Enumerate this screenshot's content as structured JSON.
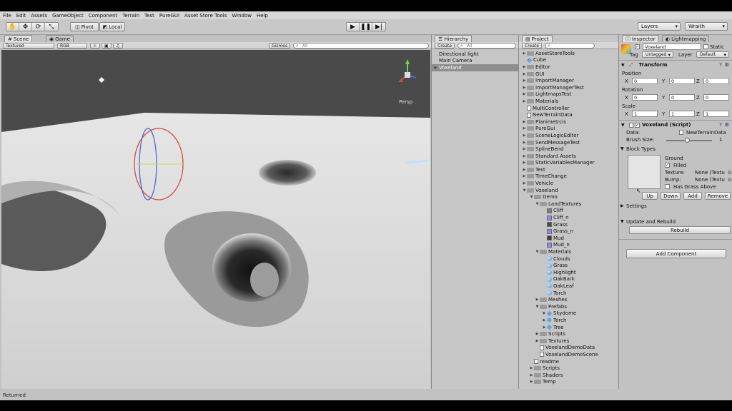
{
  "menu": [
    "File",
    "Edit",
    "Assets",
    "GameObject",
    "Component",
    "Terrain",
    "Test",
    "PureGUI",
    "Asset Store Tools",
    "Window",
    "Help"
  ],
  "toolbar": {
    "pivot_label": "Pivot",
    "local_label": "Local",
    "layers_label": "Layers",
    "layout_label": "Wraith"
  },
  "scene": {
    "tab_scene": "Scene",
    "tab_game": "Game",
    "render_mode": "Textured",
    "color_mode": "RGB",
    "gizmos_label": "Gizmos",
    "search_placeholder": "All",
    "persp_label": "Persp",
    "status_text": "Returned"
  },
  "hierarchy": {
    "tab": "Hierarchy",
    "create_label": "Create",
    "search_placeholder": "All",
    "items": [
      "Directional light",
      "Main Camera",
      "Voxeland"
    ],
    "selected": "Voxeland"
  },
  "project": {
    "tab": "Project",
    "create_label": "Create",
    "items": [
      {
        "label": "AssetStoreTools",
        "icon": "folder-icon",
        "indent": 0,
        "arrow": "▶"
      },
      {
        "label": "Cube",
        "icon": "prefab-icon",
        "indent": 0,
        "arrow": ""
      },
      {
        "label": "Editor",
        "icon": "folder-icon",
        "indent": 0,
        "arrow": "▶"
      },
      {
        "label": "GUI",
        "icon": "folder-icon",
        "indent": 0,
        "arrow": "▶"
      },
      {
        "label": "ImportManager",
        "icon": "folder-icon",
        "indent": 0,
        "arrow": "▶"
      },
      {
        "label": "ImportManagerTest",
        "icon": "folder-icon",
        "indent": 0,
        "arrow": "▶"
      },
      {
        "label": "LightmapsTest",
        "icon": "folder-icon",
        "indent": 0,
        "arrow": "▶"
      },
      {
        "label": "Materials",
        "icon": "folder-icon",
        "indent": 0,
        "arrow": "▶"
      },
      {
        "label": "MultiController",
        "icon": "script-icon",
        "indent": 0,
        "arrow": ""
      },
      {
        "label": "NewTerrainData",
        "icon": "asset-icon",
        "indent": 0,
        "arrow": ""
      },
      {
        "label": "Planimetrcis",
        "icon": "folder-icon",
        "indent": 0,
        "arrow": "▶"
      },
      {
        "label": "PureGui",
        "icon": "folder-icon",
        "indent": 0,
        "arrow": "▶"
      },
      {
        "label": "SceneLogicEditor",
        "icon": "folder-icon",
        "indent": 0,
        "arrow": "▶"
      },
      {
        "label": "SendMessageTest",
        "icon": "folder-icon",
        "indent": 0,
        "arrow": "▶"
      },
      {
        "label": "SplineBend",
        "icon": "folder-icon",
        "indent": 0,
        "arrow": "▶"
      },
      {
        "label": "Standard Assets",
        "icon": "folder-icon",
        "indent": 0,
        "arrow": "▶"
      },
      {
        "label": "StaticVariablesManager",
        "icon": "folder-icon",
        "indent": 0,
        "arrow": "▶"
      },
      {
        "label": "Test",
        "icon": "folder-icon",
        "indent": 0,
        "arrow": "▶"
      },
      {
        "label": "TimeChange",
        "icon": "folder-icon",
        "indent": 0,
        "arrow": "▶"
      },
      {
        "label": "Vehicle",
        "icon": "folder-icon",
        "indent": 0,
        "arrow": "▶"
      },
      {
        "label": "Voxeland",
        "icon": "folder-icon",
        "indent": 0,
        "arrow": "▼"
      },
      {
        "label": "Demo",
        "icon": "folder-icon",
        "indent": 1,
        "arrow": "▼"
      },
      {
        "label": "LandTextures",
        "icon": "folder-icon",
        "indent": 2,
        "arrow": "▼"
      },
      {
        "label": "Cliff",
        "icon": "texture-icon",
        "indent": 3,
        "arrow": "",
        "swatch": "#7c7c7c"
      },
      {
        "label": "Cliff_n",
        "icon": "texture-icon",
        "indent": 3,
        "arrow": "",
        "swatch": "#8a8aff"
      },
      {
        "label": "Grass",
        "icon": "texture-icon",
        "indent": 3,
        "arrow": "",
        "swatch": "#4a4a3a"
      },
      {
        "label": "Grass_n",
        "icon": "texture-icon",
        "indent": 3,
        "arrow": "",
        "swatch": "#8a8aff"
      },
      {
        "label": "Mud",
        "icon": "texture-icon",
        "indent": 3,
        "arrow": "",
        "swatch": "#4a3a32"
      },
      {
        "label": "Mud_n",
        "icon": "texture-icon",
        "indent": 3,
        "arrow": "",
        "swatch": "#8a8aff"
      },
      {
        "label": "Materials",
        "icon": "folder-icon",
        "indent": 2,
        "arrow": "▼"
      },
      {
        "label": "Clouds",
        "icon": "material-icon",
        "indent": 3,
        "arrow": ""
      },
      {
        "label": "Grass",
        "icon": "material-icon",
        "indent": 3,
        "arrow": ""
      },
      {
        "label": "Highlight",
        "icon": "material-icon",
        "indent": 3,
        "arrow": ""
      },
      {
        "label": "OakBark",
        "icon": "material-icon",
        "indent": 3,
        "arrow": ""
      },
      {
        "label": "OakLeaf",
        "icon": "material-icon",
        "indent": 3,
        "arrow": ""
      },
      {
        "label": "Torch",
        "icon": "material-icon",
        "indent": 3,
        "arrow": ""
      },
      {
        "label": "Meshes",
        "icon": "folder-icon",
        "indent": 2,
        "arrow": "▶"
      },
      {
        "label": "Prefabs",
        "icon": "folder-icon",
        "indent": 2,
        "arrow": "▼"
      },
      {
        "label": "Skydome",
        "icon": "prefab-icon",
        "indent": 3,
        "arrow": "▶"
      },
      {
        "label": "Torch",
        "icon": "prefab-icon",
        "indent": 3,
        "arrow": "▶"
      },
      {
        "label": "Tree",
        "icon": "prefab-icon",
        "indent": 3,
        "arrow": "▶"
      },
      {
        "label": "Scripts",
        "icon": "folder-icon",
        "indent": 2,
        "arrow": "▶"
      },
      {
        "label": "Textures",
        "icon": "folder-icon",
        "indent": 2,
        "arrow": "▶"
      },
      {
        "label": "VoxelandDemoData",
        "icon": "asset-icon",
        "indent": 2,
        "arrow": ""
      },
      {
        "label": "VoxelandDemoScene",
        "icon": "scene-icon",
        "indent": 2,
        "arrow": ""
      },
      {
        "label": "readme",
        "icon": "doc-icon",
        "indent": 1,
        "arrow": ""
      },
      {
        "label": "Scripts",
        "icon": "folder-icon",
        "indent": 1,
        "arrow": "▶"
      },
      {
        "label": "Shaders",
        "icon": "folder-icon",
        "indent": 1,
        "arrow": "▶"
      },
      {
        "label": "Temp",
        "icon": "folder-icon",
        "indent": 1,
        "arrow": "▶"
      }
    ]
  },
  "inspector": {
    "tab": "Inspector",
    "tab2": "Lightmapping",
    "object_name": "Voxeland",
    "static_label": "Static",
    "tag_label": "Tag",
    "tag_value": "Untagged",
    "layer_label": "Layer",
    "layer_value": "Default",
    "transform_title": "Transform",
    "position_label": "Position",
    "rotation_label": "Rotation",
    "scale_label": "Scale",
    "axis_x": "X",
    "axis_y": "Y",
    "axis_z": "Z",
    "position": [
      "0",
      "0",
      "0"
    ],
    "rotation": [
      "0",
      "0",
      "0"
    ],
    "scale": [
      "1",
      "1",
      "1"
    ],
    "script_title": "Voxeland (Script)",
    "data_label": "Data:",
    "data_value": "NewTerrainData",
    "brush_label": "Brush Size:",
    "brush_value": "1",
    "brush_level": 0.45,
    "block_types_label": "Block Types",
    "block_name": "Ground",
    "filled_label": "Filled",
    "texture_label": "Texture:",
    "texture_value": "None (Textu",
    "bump_label": "Bump:",
    "bump_value": "None (Textu",
    "has_grass_label": "Has Grass Above",
    "up_label": "Up",
    "down_label": "Down",
    "add_label": "Add",
    "remove_label": "Remove",
    "settings_label": "Settings",
    "update_label": "Update and Rebuild",
    "rebuild_label": "Rebuild",
    "add_component_label": "Add Component"
  }
}
